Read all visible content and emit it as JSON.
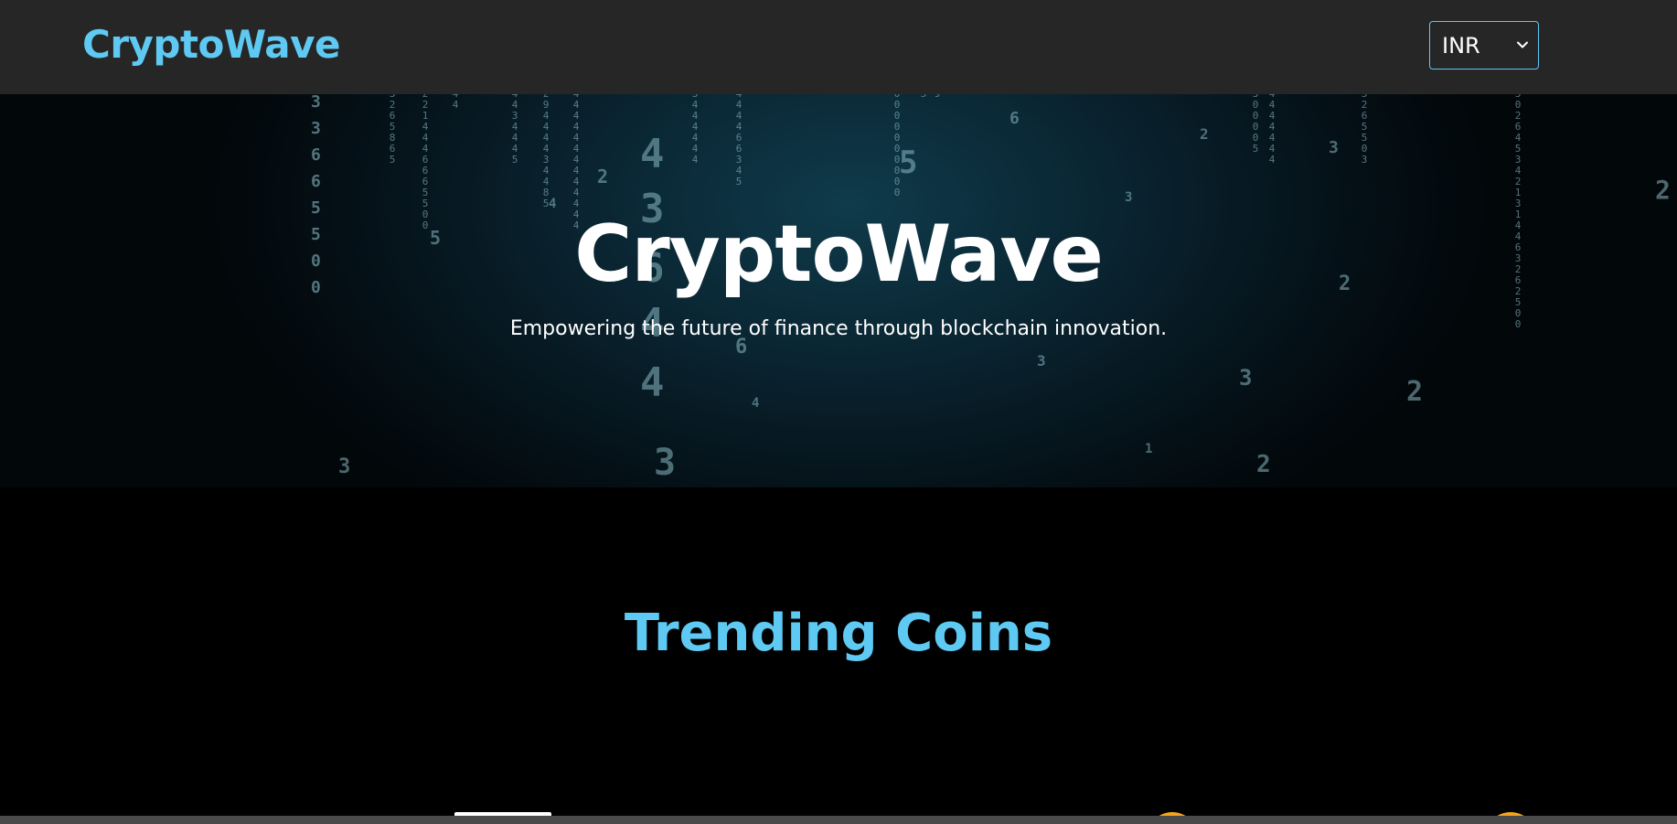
{
  "header": {
    "brand": "CryptoWave",
    "currency_select": {
      "selected": "INR",
      "icon": "chevron-down-icon"
    }
  },
  "hero": {
    "title": "CryptoWave",
    "tagline": "Empowering the future of finance through blockchain innovation."
  },
  "trending": {
    "title": "Trending Coins"
  },
  "colors": {
    "accent": "#5ec9f2",
    "header_bg": "#262626",
    "page_bg": "#000000",
    "coin_gold": "#f3a51d"
  }
}
